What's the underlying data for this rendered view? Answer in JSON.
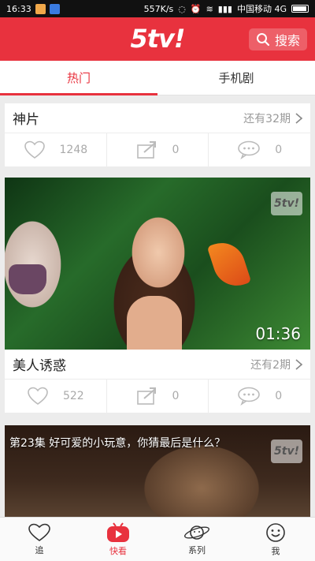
{
  "status_bar": {
    "time": "16:33",
    "speed": "557K/s",
    "carrier": "中国移动 4G"
  },
  "header": {
    "logo": "5tv!",
    "search_label": "搜索"
  },
  "tabs": [
    {
      "label": "热门",
      "active": true
    },
    {
      "label": "手机剧",
      "active": false
    }
  ],
  "cards": [
    {
      "title": "神片",
      "more": "还有32期",
      "likes": "1248",
      "shares": "0",
      "comments": "0"
    },
    {
      "title": "美人诱惑",
      "more": "还有2期",
      "duration": "01:36",
      "watermark": "5tv!",
      "likes": "522",
      "shares": "0",
      "comments": "0"
    },
    {
      "episode_title": "第23集 好可爱的小玩意，你猜最后是什么？",
      "watermark": "5tv!"
    }
  ],
  "bottom_nav": [
    {
      "label": "追",
      "icon": "heart-icon"
    },
    {
      "label": "快看",
      "icon": "play-tv-icon",
      "active": true
    },
    {
      "label": "系列",
      "icon": "planet-icon"
    },
    {
      "label": "我",
      "icon": "smiley-icon"
    }
  ],
  "colors": {
    "brand_red": "#e8323e"
  }
}
